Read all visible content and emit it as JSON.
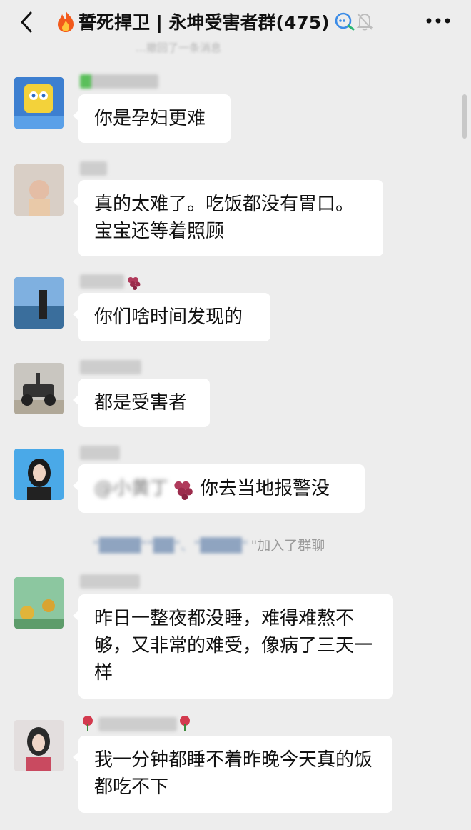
{
  "header": {
    "title": "誓死捍卫 | 永坤受害者群(475)",
    "back_icon": "chevron-left-icon",
    "flame_icon": "flame-icon",
    "tag_icon": "group-tag-icon",
    "mute_icon": "bell-off-icon",
    "more_icon": "more-dots-icon"
  },
  "notice": {
    "text": "…撤回了一条消息"
  },
  "messages": [
    {
      "text": "你是孕妇更难"
    },
    {
      "text": "真的太难了。吃饭都没有胃口。宝宝还等着照顾"
    },
    {
      "text": "你们啥时间发现的"
    },
    {
      "text": "都是受害者"
    },
    {
      "mention": "@小黄丁",
      "text": "你去当地报警没"
    },
    {
      "text": "昨日一整夜都没睡，难得难熬不够，又非常的难受，像病了三天一样"
    },
    {
      "text": "我一分钟都睡不着昨晚今天真的饭都吃不下"
    }
  ],
  "system": {
    "blurred": "\"████\"\"██\"、\"████\"",
    "text": "\"加入了群聊"
  },
  "colors": {
    "background": "#ededed",
    "bubble": "#ffffff",
    "system_text": "#9a9a9a"
  }
}
